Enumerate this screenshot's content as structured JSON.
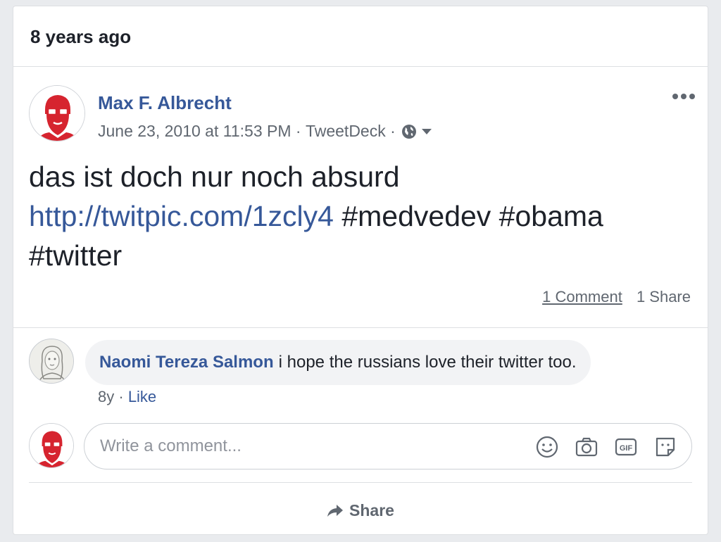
{
  "memory": {
    "header": "8 years ago"
  },
  "post": {
    "author": "Max F. Albrecht",
    "date": "June 23, 2010 at 11:53 PM",
    "separator": " · ",
    "source": "TweetDeck",
    "source_separator": " ·",
    "privacy_icon": "globe-icon",
    "text_prefix": "das ist doch nur noch absurd",
    "link": "http://twitpic.com/1zcly4",
    "text_suffix": " #medvedev #obama #twitter",
    "comments_count": "1 Comment",
    "shares_count": "1 Share"
  },
  "comment": {
    "author": "Naomi Tereza Salmon",
    "text": "i hope the russians love their twitter too.",
    "age": "8y",
    "dot": " · ",
    "like_label": "Like"
  },
  "compose": {
    "placeholder": "Write a comment...",
    "icons": [
      "emoji-icon",
      "camera-icon",
      "gif-icon",
      "sticker-icon"
    ]
  },
  "actions": {
    "share_label": "Share"
  },
  "colors": {
    "link_blue": "#365899",
    "text_dark": "#1d2129",
    "text_gray": "#606770",
    "avatar_red": "#d6242f",
    "bubble_bg": "#f2f3f5",
    "divider": "#dddfe2"
  }
}
